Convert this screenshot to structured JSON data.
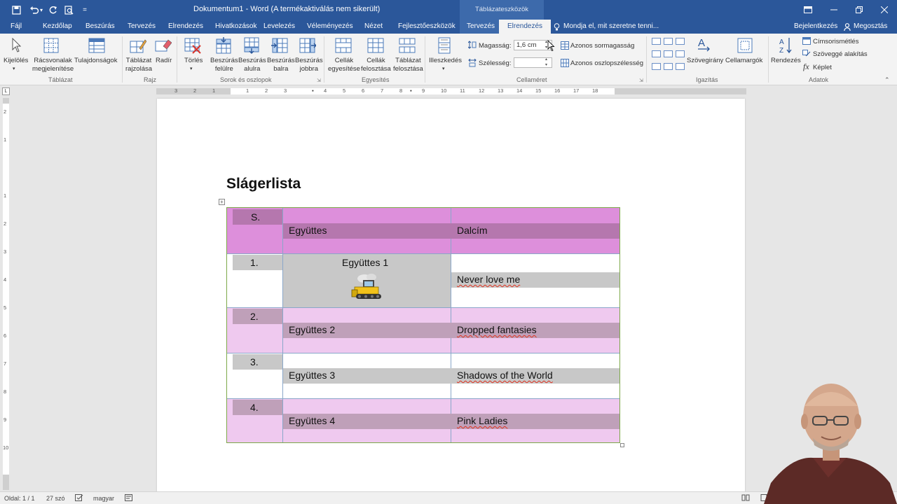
{
  "titlebar": {
    "doc_title": "Dokumentum1 - Word (A termékaktiválás nem sikerült)",
    "context_group": "Táblázateszközök",
    "qa_more": "="
  },
  "tabs": {
    "file": "Fájl",
    "home": "Kezdőlap",
    "insert": "Beszúrás",
    "design": "Tervezés",
    "layout": "Elrendezés",
    "references": "Hivatkozások",
    "mailings": "Levelezés",
    "review": "Véleményezés",
    "view": "Nézet",
    "developer": "Fejlesztőeszközök",
    "table_design": "Tervezés",
    "table_layout": "Elrendezés",
    "tell_me": "Mondja el, mit szeretne tenni...",
    "signin": "Bejelentkezés",
    "share": "Megosztás"
  },
  "ribbon": {
    "g_table": {
      "label": "Táblázat",
      "select": "Kijelölés",
      "gridlines_1": "Rácsvonalak",
      "gridlines_2": "megjelenítése",
      "properties": "Tulajdonságok"
    },
    "g_draw": {
      "label": "Rajz",
      "draw_1": "Táblázat",
      "draw_2": "rajzolása",
      "eraser": "Radír"
    },
    "g_rows": {
      "label": "Sorok és oszlopok",
      "delete": "Törlés",
      "above_1": "Beszúrás",
      "above_2": "felülre",
      "below_1": "Beszúrás",
      "below_2": "alulra",
      "left_1": "Beszúrás",
      "left_2": "balra",
      "right_1": "Beszúrás",
      "right_2": "jobbra"
    },
    "g_merge": {
      "label": "Egyesítés",
      "merge_1": "Cellák",
      "merge_2": "egyesítése",
      "split_1": "Cellák",
      "split_2": "felosztása",
      "splittbl_1": "Táblázat",
      "splittbl_2": "felosztása"
    },
    "g_autofit": {
      "autofit": "Illeszkedés"
    },
    "g_cellsize": {
      "label": "Cellaméret",
      "height_label": "Magasság:",
      "height_value": "1,6 cm",
      "width_label": "Szélesség:",
      "width_value": "",
      "dist_rows": "Azonos sormagasság",
      "dist_cols": "Azonos oszlopszélesség"
    },
    "g_align": {
      "label": "Igazítás",
      "direction": "Szövegirány",
      "margins": "Cellamargók"
    },
    "g_data": {
      "label": "Adatok",
      "sort": "Rendezés",
      "repeat_header": "Címsorismétlés",
      "to_text": "Szöveggé alakítás",
      "formula": "Képlet"
    }
  },
  "ruler": {
    "h_left": [
      "3",
      "2",
      "1"
    ],
    "h_right": [
      "1",
      "2",
      "3",
      "4",
      "5",
      "6",
      "7",
      "8",
      "9",
      "10",
      "11",
      "12",
      "13",
      "14",
      "15",
      "16",
      "17",
      "18"
    ],
    "v": [
      "2",
      "1",
      "1",
      "2",
      "3",
      "4",
      "5",
      "6",
      "7",
      "8",
      "9",
      "10"
    ]
  },
  "document": {
    "heading": "Slágerlista",
    "table": {
      "headers": [
        "S.",
        "Együttes",
        "Dalcím"
      ],
      "rows": [
        {
          "no": "1.",
          "band": "Együttes 1",
          "song": "Never love me"
        },
        {
          "no": "2.",
          "band": "Együttes 2",
          "song": "Dropped fantasies"
        },
        {
          "no": "3.",
          "band": "Együttes 3",
          "song": "Shadows of the World"
        },
        {
          "no": "4.",
          "band": "Együttes 4",
          "song": "Pink Ladies"
        }
      ]
    }
  },
  "statusbar": {
    "page": "Oldal: 1 / 1",
    "words": "27 szó",
    "language": "magyar"
  },
  "colors": {
    "word_blue": "#2b579a",
    "header_pink": "#dd8fdb",
    "header_band": "#b577ae",
    "row_pink": "#efc9ef",
    "row_band": "#bfa0b9",
    "gray_band": "#c8c8c8"
  }
}
